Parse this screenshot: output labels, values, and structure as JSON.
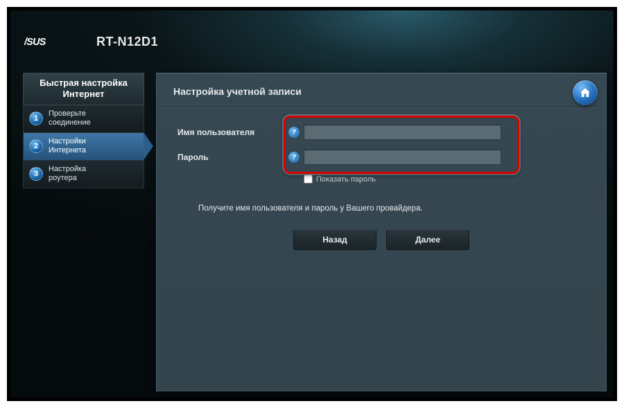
{
  "header": {
    "brand": "ASUS",
    "model": "RT-N12D1"
  },
  "sidebar": {
    "title_l1": "Быстрая настройка",
    "title_l2": "Интернет",
    "steps": [
      {
        "num": "1",
        "label_l1": "Проверьте",
        "label_l2": "соединение"
      },
      {
        "num": "2",
        "label_l1": "Настройки",
        "label_l2": "Интернета"
      },
      {
        "num": "3",
        "label_l1": "Настройка",
        "label_l2": "роутера"
      }
    ]
  },
  "panel": {
    "title": "Настройка учетной записи",
    "username_label": "Имя пользователя",
    "password_label": "Пароль",
    "hint_glyph": "?",
    "show_password": "Показать пароль",
    "info": "Получите имя пользователя и пароль у Вашего провайдера.",
    "back": "Назад",
    "next": "Далее"
  }
}
